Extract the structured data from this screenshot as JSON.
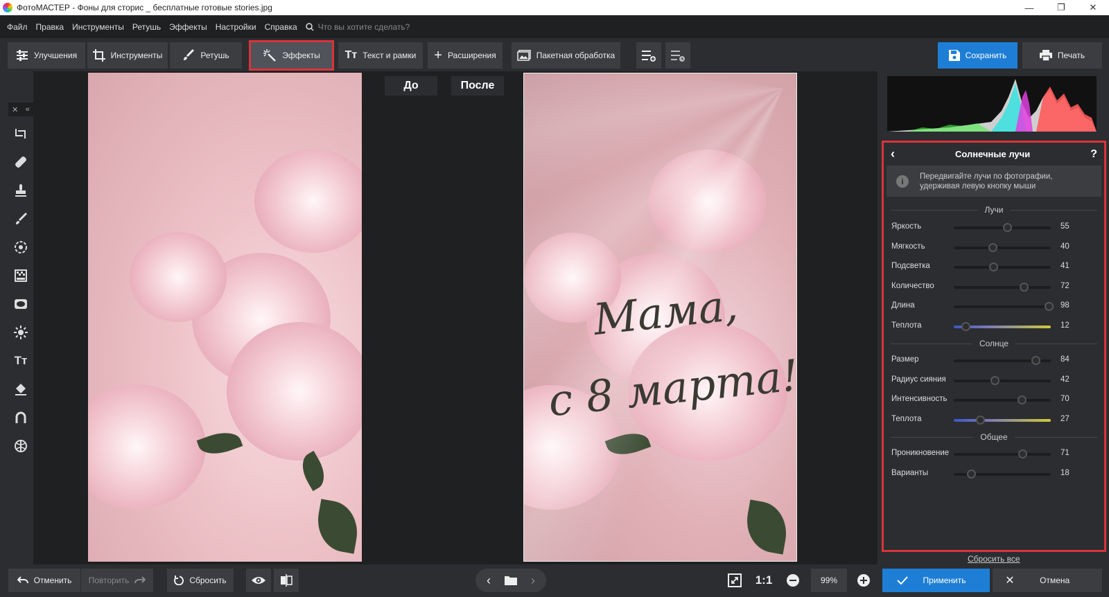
{
  "window": {
    "title": "ФотоМАСТЕР - Фоны для сторис _ бесплатные готовые stories.jpg"
  },
  "menu": {
    "items": [
      "Файл",
      "Правка",
      "Инструменты",
      "Ретушь",
      "Эффекты",
      "Настройки",
      "Справка"
    ],
    "search_placeholder": "Что вы хотите сделать?"
  },
  "toolbar": {
    "tabs": [
      "Улучшения",
      "Инструменты",
      "Ретушь",
      "Эффекты",
      "Текст и рамки",
      "Расширения",
      "Пакетная обработка"
    ],
    "active_tab": "Эффекты",
    "save_label": "Сохранить",
    "print_label": "Печать"
  },
  "compare": {
    "before": "До",
    "after": "После"
  },
  "photo": {
    "greeting_line1": "Мама,",
    "greeting_line2": "с 8 марта!"
  },
  "panel": {
    "title": "Солнечные лучи",
    "help": "?",
    "info_line1": "Передвигайте лучи по фотографии,",
    "info_line2": "удерживая левую кнопку мыши",
    "sections": {
      "rays": "Лучи",
      "sun": "Солнце",
      "general": "Общее"
    },
    "rays": [
      {
        "label": "Яркость",
        "value": 55
      },
      {
        "label": "Мягкость",
        "value": 40
      },
      {
        "label": "Подсветка",
        "value": 41
      },
      {
        "label": "Количество",
        "value": 72
      },
      {
        "label": "Длина",
        "value": 98
      },
      {
        "label": "Теплота",
        "value": 12
      }
    ],
    "sun": [
      {
        "label": "Размер",
        "value": 84
      },
      {
        "label": "Радиус сияния",
        "value": 42
      },
      {
        "label": "Интенсивность",
        "value": 70
      },
      {
        "label": "Теплота",
        "value": 27
      }
    ],
    "general": [
      {
        "label": "Проникновение",
        "value": 71
      },
      {
        "label": "Варианты",
        "value": 18
      }
    ],
    "reset_all": "Сбросить все"
  },
  "bottom": {
    "undo": "Отменить",
    "redo": "Повторить",
    "reset": "Сбросить",
    "zoom_1to1": "1:1",
    "zoom": "99%",
    "apply": "Применить",
    "cancel": "Отмена"
  },
  "colors": {
    "accent": "#1e7ed6",
    "highlight": "#d9343a"
  }
}
